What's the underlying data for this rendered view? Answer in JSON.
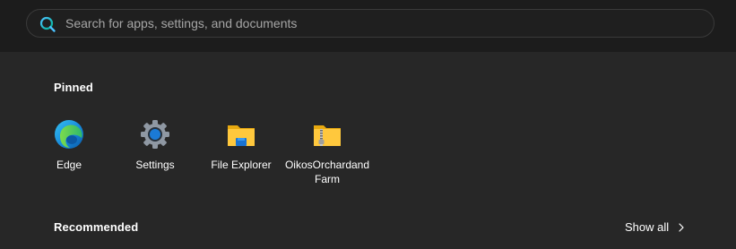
{
  "search": {
    "placeholder": "Search for apps, settings, and documents",
    "icon": "search-icon"
  },
  "pinned": {
    "title": "Pinned",
    "apps": [
      {
        "label": "Edge",
        "icon": "edge-icon"
      },
      {
        "label": "Settings",
        "icon": "settings-gear-icon"
      },
      {
        "label": "File Explorer",
        "icon": "file-explorer-folder-icon"
      },
      {
        "label": "OikosOrchardandFarm",
        "icon": "zip-folder-icon"
      }
    ]
  },
  "recommended": {
    "title": "Recommended",
    "show_all_label": "Show all",
    "show_all_icon": "chevron-right-icon"
  },
  "colors": {
    "background": "#272727",
    "top_band": "#1c1c1c",
    "accent": "#0078d4"
  }
}
